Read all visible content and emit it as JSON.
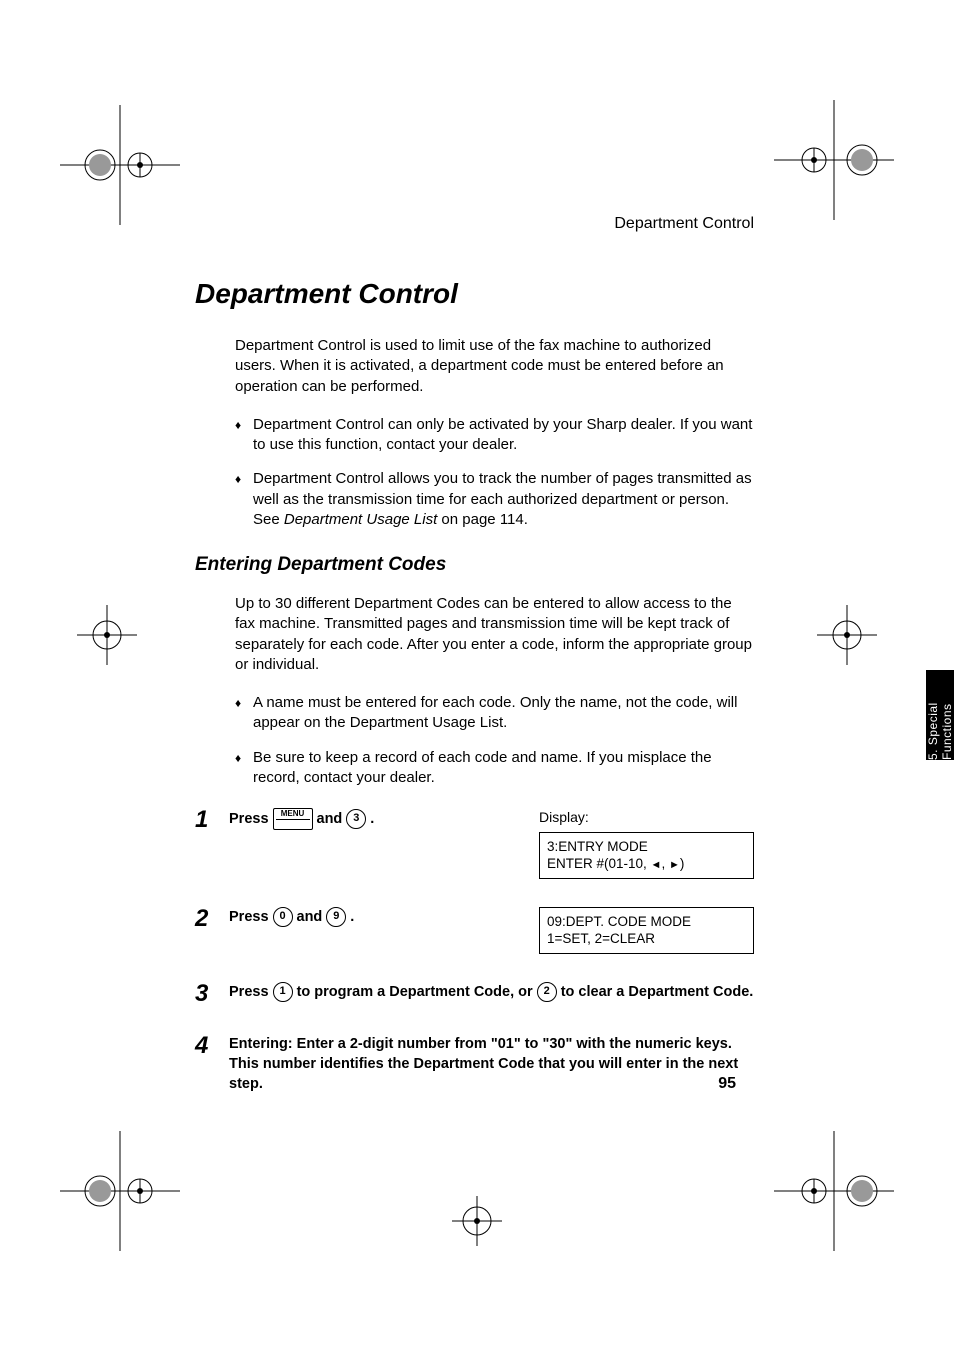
{
  "running_head": "Department Control",
  "title": "Department Control",
  "intro": "Department Control is used to limit use of the fax machine to authorized users. When it is activated, a department code must be entered before an operation can be performed.",
  "bullets_top": [
    "Department Control can only be activated by your Sharp dealer. If you want to use this function, contact your dealer.",
    "Department Control allows you to track the number of pages transmitted as well as the transmission time for each authorized department or person. See "
  ],
  "dept_usage_ref": "Department Usage List",
  "dept_usage_page": " on page 114.",
  "subhead": "Entering Department Codes",
  "sub_intro": "Up to 30 different Department Codes can be entered to allow access to the fax machine. Transmitted pages and transmission time will be kept track of separately for each code. After you enter a code, inform the appropriate group or individual.",
  "bullets_sub": [
    "A name must be entered for each code. Only the name, not the code, will appear on the Department Usage List.",
    "Be sure to keep a record of each code and name. If you misplace the record, contact your dealer."
  ],
  "display_label": "Display:",
  "steps": {
    "s1": {
      "press": "Press",
      "menu_label": "MENU",
      "and": " and ",
      "key": "3",
      "period": ".",
      "lcd1": "3:ENTRY MODE",
      "lcd2_a": "ENTER #(01-10, ",
      "lcd2_b": ")"
    },
    "s2": {
      "press": "Press ",
      "key_a": "0",
      "and": " and ",
      "key_b": "9",
      "period": ".",
      "lcd1": "09:DEPT. CODE MODE",
      "lcd2": "1=SET, 2=CLEAR"
    },
    "s3": {
      "pre": "Press  ",
      "key_a": "1",
      "mid": " to program a Department Code, or ",
      "key_b": "2",
      "post": " to clear a Department Code."
    },
    "s4": "Entering: Enter a 2-digit number from \"01\" to \"30\" with the numeric keys. This number identifies the Department Code that you will enter in the next step."
  },
  "side_tab": "5. Special Functions",
  "page_number": "95"
}
